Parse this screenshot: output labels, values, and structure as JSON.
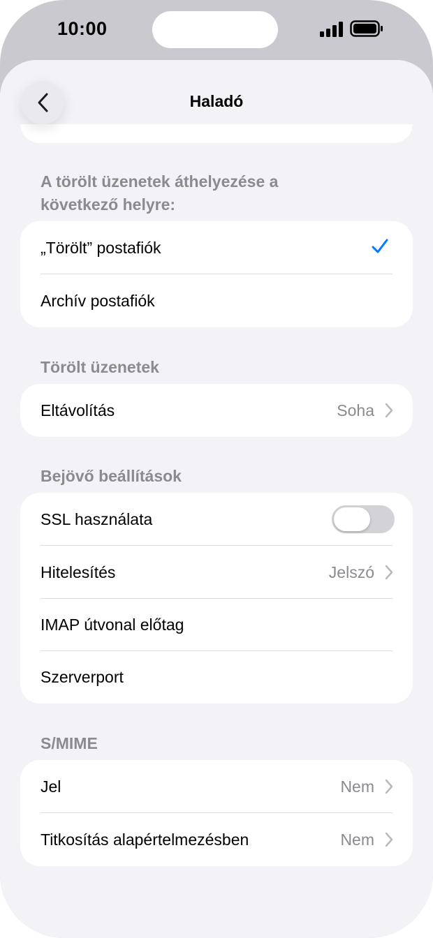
{
  "status_bar": {
    "time": "10:00"
  },
  "nav": {
    "title": "Haladó",
    "back_icon": "chevron-left-icon"
  },
  "deleted_move": {
    "header": "A törölt üzenetek áthelyezése a következő helyre:",
    "options": [
      {
        "label": "„Törölt” postafiók",
        "selected": true
      },
      {
        "label": "Archív postafiók",
        "selected": false
      }
    ]
  },
  "deleted_messages": {
    "header": "Törölt üzenetek",
    "remove": {
      "label": "Eltávolítás",
      "value": "Soha"
    }
  },
  "incoming": {
    "header": "Bejövő beállítások",
    "ssl": {
      "label": "SSL használata",
      "on": false
    },
    "auth": {
      "label": "Hitelesítés",
      "value": "Jelszó"
    },
    "imap_prefix": {
      "label": "IMAP útvonal előtag"
    },
    "server_port": {
      "label": "Szerverport"
    }
  },
  "smime": {
    "header": "S/MIME",
    "sign": {
      "label": "Jel",
      "value": "Nem"
    },
    "encrypt": {
      "label": "Titkosítás alapértelmezésben",
      "value": "Nem"
    }
  },
  "colors": {
    "accent": "#007aff",
    "background": "#f2f2f7",
    "secondary_text": "#8a8a8f"
  }
}
